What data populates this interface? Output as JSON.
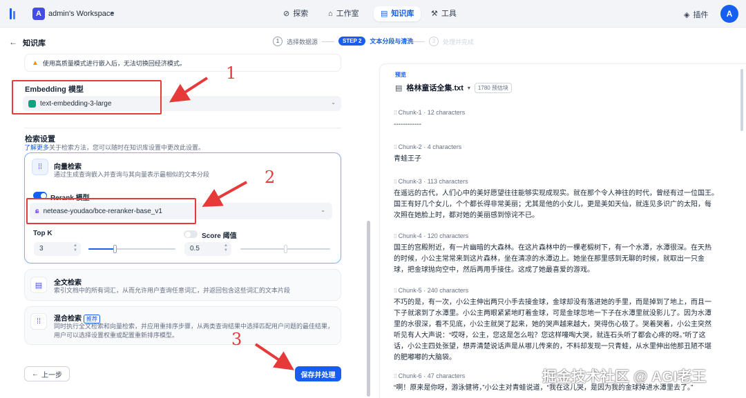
{
  "topbar": {
    "workspace_initial": "A",
    "workspace_name": "admin's Workspace",
    "nav": [
      {
        "label": "探索",
        "icon": "compass-icon"
      },
      {
        "label": "工作室",
        "icon": "robot-icon"
      },
      {
        "label": "知识库",
        "icon": "book-icon",
        "active": true
      },
      {
        "label": "工具",
        "icon": "tool-icon"
      }
    ],
    "plugins_label": "插件",
    "avatar_initial": "A"
  },
  "subheader": {
    "title": "知识库",
    "steps": [
      {
        "num": "1",
        "label": "选择数据源"
      },
      {
        "num": "STEP 2",
        "label": "文本分段与清洗"
      },
      {
        "num": "3",
        "label": "处理并完成"
      }
    ]
  },
  "left": {
    "warning": "使用高质量模式进行嵌入后，无法切换回经济模式。",
    "embedding_label": "Embedding 模型",
    "embedding_model": "text-embedding-3-large",
    "search_title": "检索设置",
    "search_desc_link": "了解更多",
    "search_desc": "关于检索方法，您可以随时在知识库设置中更改此设置。",
    "vector": {
      "title": "向量检索",
      "desc": "通过生成查询嵌入并查询与其向量表示最相似的文本分段",
      "rerank_label": "Rerank 模型",
      "rerank_model": "netease-youdao/bce-reranker-base_v1",
      "topk_label": "Top K",
      "topk_value": "3",
      "topk_level": 0.3,
      "score_label": "Score 阈值",
      "score_value": "0.5",
      "score_level": 0.5
    },
    "fulltext": {
      "title": "全文检索",
      "desc": "索引文档中的所有词汇，从而允许用户查询任意词汇，并返回包含这些词汇的文本片段"
    },
    "hybrid": {
      "title": "混合检索",
      "badge": "推荐",
      "desc1": "同时执行全文检索和向量检索，并应用重排序步骤，从两类查询结果中选择匹配用户问题的最佳结果，",
      "desc2": "用户可以选择设置权重或配置重新排序模型。"
    },
    "prev_button": "上一步",
    "save_button": "保存并处理"
  },
  "annotations": {
    "n1": "1",
    "n2": "2",
    "n3": "3"
  },
  "right": {
    "preview_tag": "预览",
    "file_name": "格林童话全集.txt",
    "chunk_count": "1780 预估块",
    "chunks": [
      {
        "label": "Chunk-1",
        "chars": "12 characters",
        "lines": [
          "------------"
        ]
      },
      {
        "label": "Chunk-2",
        "chars": "4 characters",
        "lines": [
          "青蛙王子"
        ]
      },
      {
        "label": "Chunk-3",
        "chars": "113 characters",
        "lines": [
          "在遥远的古代，人们心中的美好愿望往往能够实现成现实。就在那个令人神往的时代，曾经有过一位国王。",
          "国王有好几个女儿，个个都长得非常美丽；尤其是他的小女儿，更是美如天仙，就连见多识广的太阳，每",
          "次照在她脸上时，都对她的美丽感到惊诧不已。"
        ]
      },
      {
        "label": "Chunk-4",
        "chars": "120 characters",
        "lines": [
          "国王的宫殿附近，有一片幽暗的大森林。在这片森林中的一棵老椴树下，有一个水潭，水潭很深。在天热",
          "的时候，小公主常常来到这片森林，坐在清凉的水潭边上。她坐在那里感到无聊的时候，就取出一只金",
          "球，把金球抛向空中，然后再用手接住。这成了她最喜爱的游戏。"
        ]
      },
      {
        "label": "Chunk-5",
        "chars": "240 characters",
        "lines": [
          "不巧的是，有一次，小公主伸出两只小手去接金球，金球却没有落进她的手里，而是掉到了地上，而且一",
          "下子就滚到了水潭里。小公主两眼紧紧地盯着金球，可是金球忽地一下子在水潭里就没影儿了。因为水潭",
          "里的水很深，看不见底，小公主就哭了起来，她的哭声越来越大，哭得伤心极了。哭着哭着，小公主突然",
          "听见有人大声说：“哎呀，公主，您这是怎么啦？您这样嚎啕大哭，就连石头听了都会心疼的呀。”听了这",
          "话，小公主四处张望，想弄清楚说话声是从哪儿传来的，不料却发现一只青蛙，从水里伸出他那丑陋不堪",
          "的肥嘟嘟的大脑袋。"
        ]
      },
      {
        "label": "Chunk-6",
        "chars": "47 characters",
        "lines": [
          "“啊！原来是你呀，游泳健将，”小公主对青蛙说道，“我在这儿哭，是因为我的金球掉进水潭里去了。”"
        ]
      }
    ]
  },
  "watermark": "掘金技术社区 @ AGI老王"
}
